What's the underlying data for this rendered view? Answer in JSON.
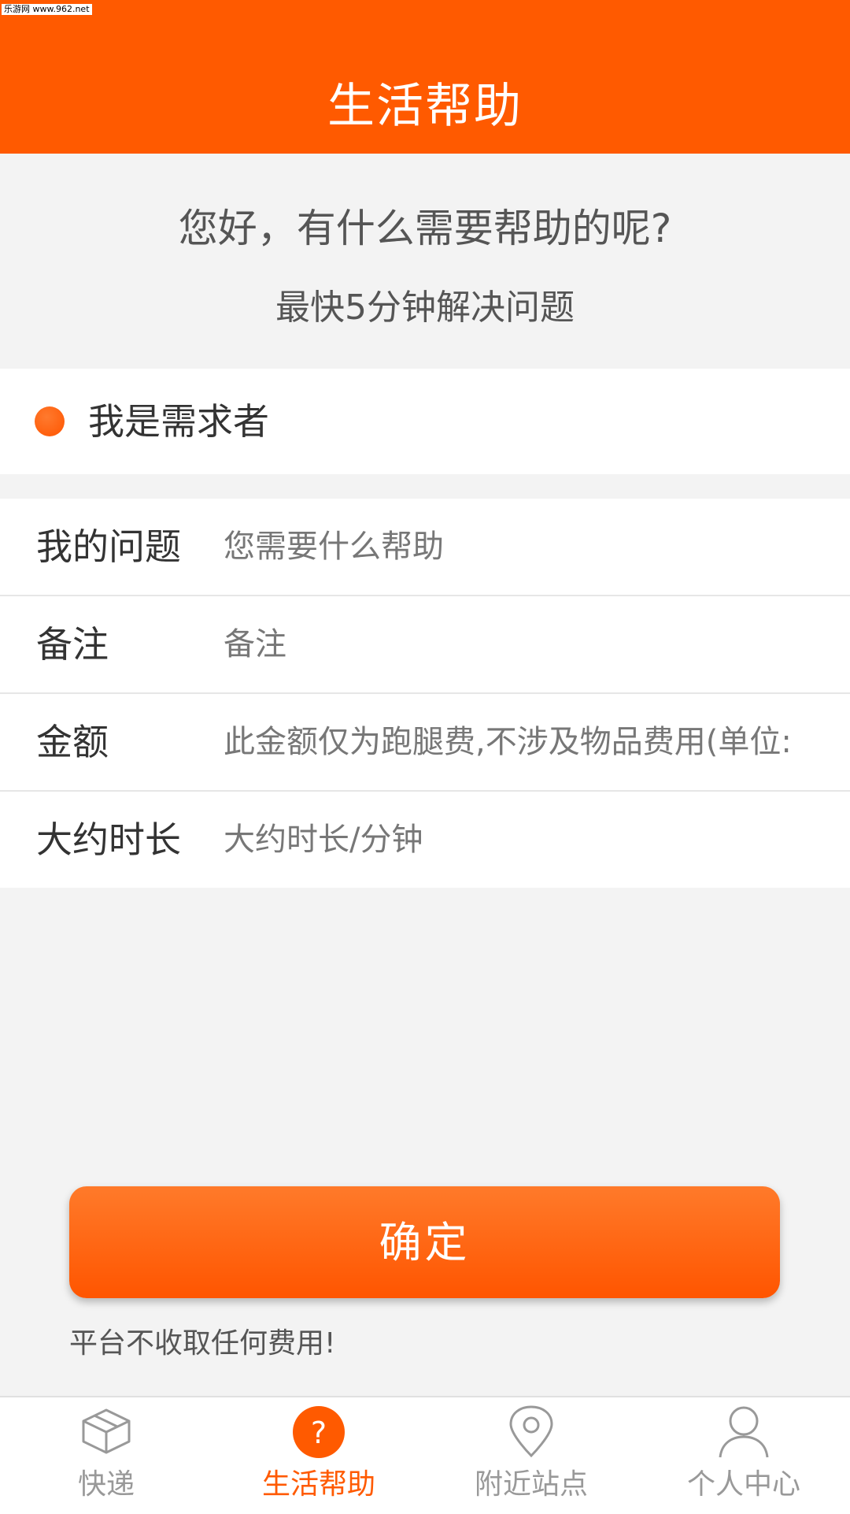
{
  "watermark": "乐游网 www.962.net",
  "header": {
    "title": "生活帮助"
  },
  "intro": {
    "title": "您好，有什么需要帮助的呢?",
    "subtitle": "最快5分钟解决问题"
  },
  "role": {
    "label": "我是需求者"
  },
  "form": {
    "rows": [
      {
        "label": "我的问题",
        "placeholder": "您需要什么帮助"
      },
      {
        "label": "备注",
        "placeholder": "备注"
      },
      {
        "label": "金额",
        "placeholder": "此金额仅为跑腿费,不涉及物品费用(单位:"
      },
      {
        "label": "大约时长",
        "placeholder": "大约时长/分钟"
      }
    ]
  },
  "confirm": {
    "label": "确定"
  },
  "note": "平台不收取任何费用!",
  "tabs": [
    {
      "label": "快递",
      "icon": "package-icon",
      "active": false
    },
    {
      "label": "生活帮助",
      "icon": "help-icon",
      "active": true
    },
    {
      "label": "附近站点",
      "icon": "location-pin-icon",
      "active": false
    },
    {
      "label": "个人中心",
      "icon": "person-icon",
      "active": false
    }
  ],
  "colors": {
    "accent": "#ff5a00",
    "background": "#f3f3f3"
  }
}
